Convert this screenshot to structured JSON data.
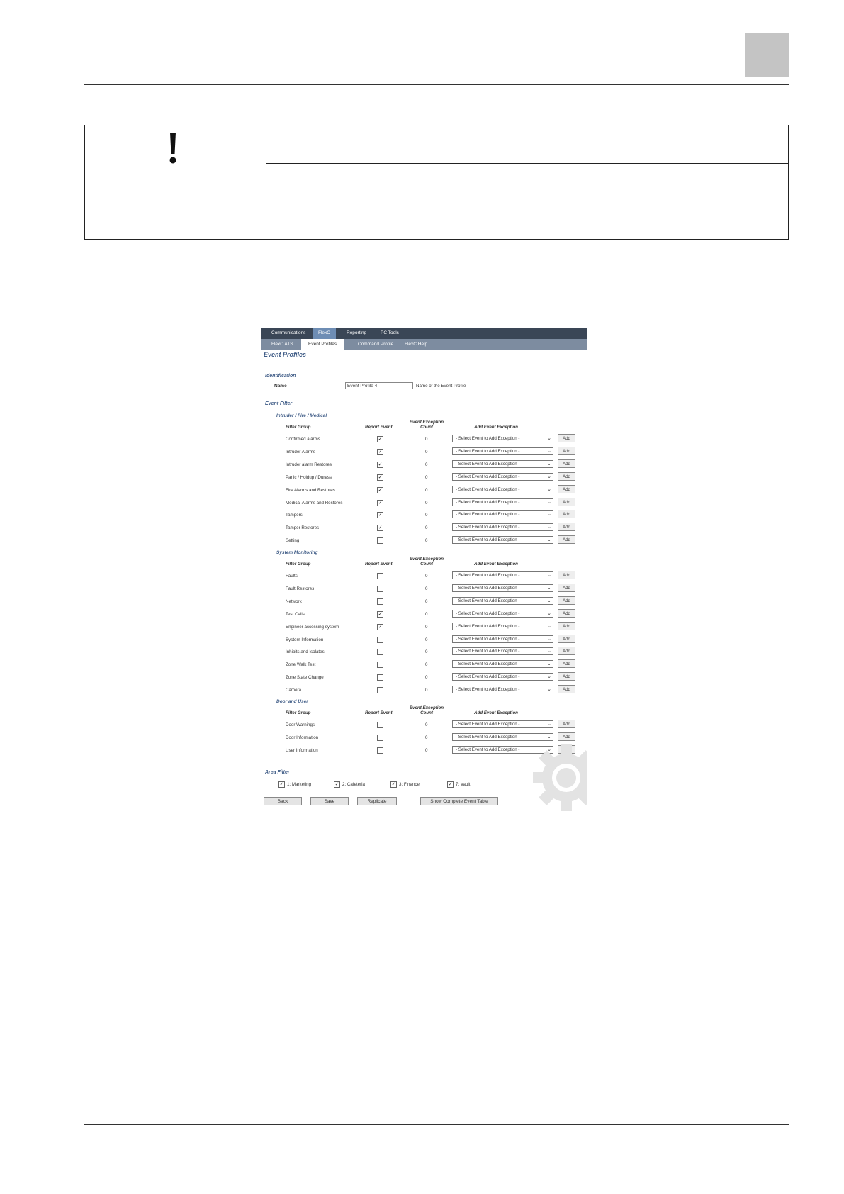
{
  "screenshot": {
    "tabs_primary": [
      "Communications",
      "FlexC",
      "Reporting",
      "PC Tools"
    ],
    "tabs_primary_active": 1,
    "tabs_secondary": [
      "FlexC ATS",
      "Event Profiles",
      "Command Profile",
      "FlexC Help"
    ],
    "tabs_secondary_active": 1,
    "page_title": "Event Profiles",
    "identification": {
      "heading": "Identification",
      "name_label": "Name",
      "name_value": "Event Profile 4",
      "name_hint": "Name of the Event Profile"
    },
    "event_filter_heading": "Event Filter",
    "columns": {
      "filter_group": "Filter Group",
      "report_event": "Report Event",
      "exception_count_1": "Event Exception",
      "exception_count_2": "Count",
      "add_exception": "Add Event Exception"
    },
    "select_placeholder": "-   Select Event to Add Exception   -",
    "add_label": "Add",
    "groups": [
      {
        "title": "Intruder / Fire / Medical",
        "rows": [
          {
            "label": "Confirmed alarms",
            "checked": true,
            "count": "0"
          },
          {
            "label": "Intruder Alarms",
            "checked": true,
            "count": "0"
          },
          {
            "label": "Intruder alarm Restores",
            "checked": true,
            "count": "0"
          },
          {
            "label": "Panic / Holdup / Duress",
            "checked": true,
            "count": "0"
          },
          {
            "label": "Fire Alarms and Restores",
            "checked": true,
            "count": "0"
          },
          {
            "label": "Medical Alarms and Restores",
            "checked": true,
            "count": "0"
          },
          {
            "label": "Tampers",
            "checked": true,
            "count": "0"
          },
          {
            "label": "Tamper Restores",
            "checked": true,
            "count": "0"
          },
          {
            "label": "Setting",
            "checked": false,
            "count": "0"
          }
        ]
      },
      {
        "title": "System Monitoring",
        "rows": [
          {
            "label": "Faults",
            "checked": false,
            "count": "0"
          },
          {
            "label": "Fault Restores",
            "checked": false,
            "count": "0"
          },
          {
            "label": "Network",
            "checked": false,
            "count": "0"
          },
          {
            "label": "Test Calls",
            "checked": true,
            "count": "0"
          },
          {
            "label": "Engineer accessing system",
            "checked": true,
            "count": "0"
          },
          {
            "label": "System Information",
            "checked": false,
            "count": "0"
          },
          {
            "label": "Inhibits and Isolates",
            "checked": false,
            "count": "0"
          },
          {
            "label": "Zone Walk Test",
            "checked": false,
            "count": "0"
          },
          {
            "label": "Zone State Change",
            "checked": false,
            "count": "0"
          },
          {
            "label": "Camera",
            "checked": false,
            "count": "0"
          }
        ]
      },
      {
        "title": "Door and User",
        "rows": [
          {
            "label": "Door Warnings",
            "checked": false,
            "count": "0"
          },
          {
            "label": "Door Information",
            "checked": false,
            "count": "0"
          },
          {
            "label": "User Information",
            "checked": false,
            "count": "0"
          }
        ]
      }
    ],
    "area_filter": {
      "heading": "Area Filter",
      "areas": [
        {
          "label": "1: Marketing",
          "checked": true
        },
        {
          "label": "2: Cafeteria",
          "checked": true
        },
        {
          "label": "3: Finance",
          "checked": true
        },
        {
          "label": "7: Vault",
          "checked": true
        }
      ]
    },
    "buttons": {
      "back": "Back",
      "save": "Save",
      "replicate": "Replicate",
      "show_table": "Show Complete Event Table"
    }
  }
}
